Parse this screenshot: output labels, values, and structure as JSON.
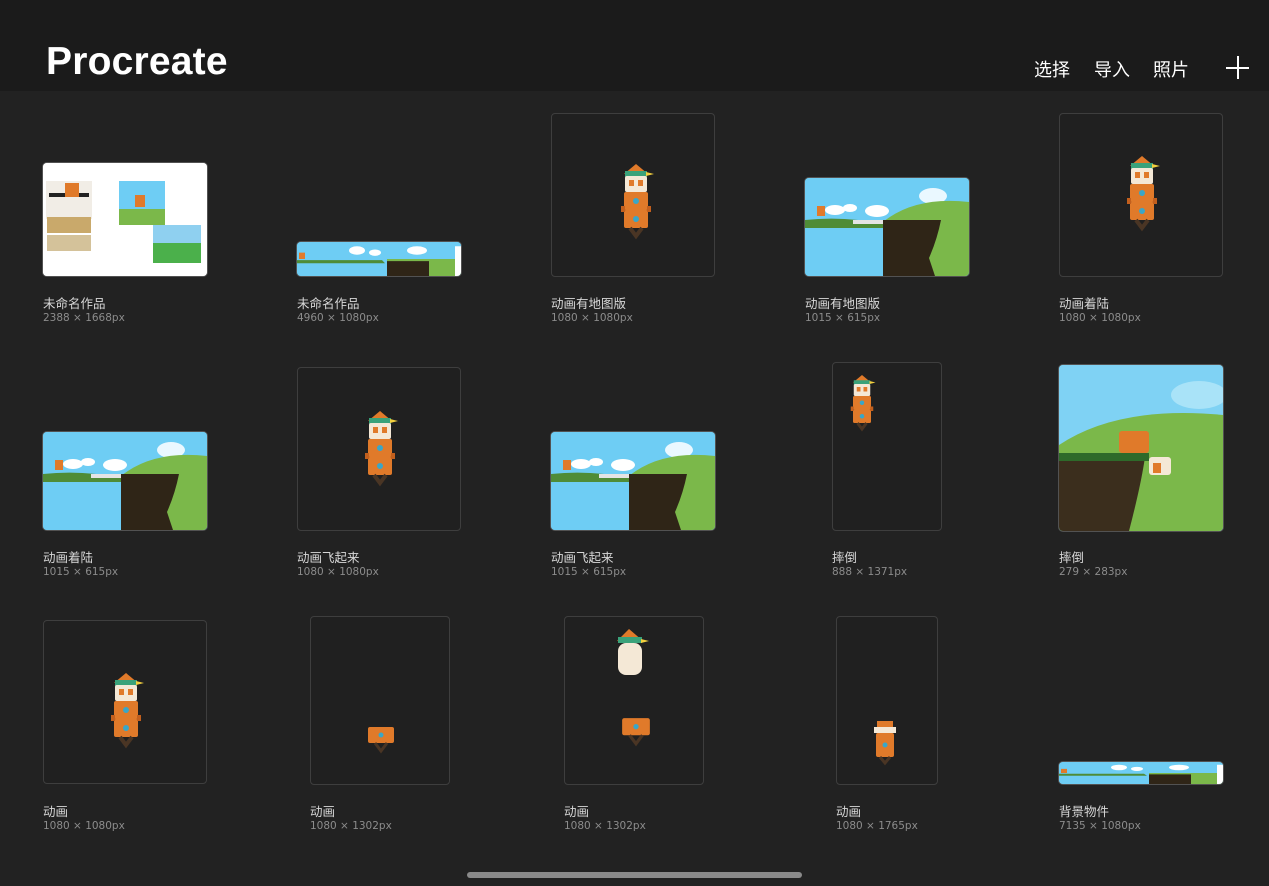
{
  "app": {
    "title": "Procreate"
  },
  "toolbar": {
    "select": "选择",
    "import": "导入",
    "photos": "照片",
    "add_icon": "plus-icon"
  },
  "colors": {
    "background": "#222222",
    "header": "#1b1b1b",
    "sky": "#6ecdf4",
    "grass": "#7bb84a",
    "cliff": "#2f2517",
    "character": "#e07a2a"
  },
  "gallery": [
    {
      "name": "未命名作品",
      "size": "2388 × 1668px"
    },
    {
      "name": "未命名作品",
      "size": "4960 × 1080px"
    },
    {
      "name": "动画有地图版",
      "size": "1080 × 1080px"
    },
    {
      "name": "动画有地图版",
      "size": "1015 × 615px"
    },
    {
      "name": "动画着陆",
      "size": "1080 × 1080px"
    },
    {
      "name": "动画着陆",
      "size": "1015 × 615px"
    },
    {
      "name": "动画飞起来",
      "size": "1080 × 1080px"
    },
    {
      "name": "动画飞起来",
      "size": "1015 × 615px"
    },
    {
      "name": "摔倒",
      "size": "888 × 1371px"
    },
    {
      "name": "摔倒",
      "size": "279 × 283px"
    },
    {
      "name": "动画",
      "size": "1080 × 1080px"
    },
    {
      "name": "动画",
      "size": "1080 × 1302px"
    },
    {
      "name": "动画",
      "size": "1080 × 1302px"
    },
    {
      "name": "动画",
      "size": "1080 × 1765px"
    },
    {
      "name": "背景物件",
      "size": "7135 × 1080px"
    }
  ]
}
